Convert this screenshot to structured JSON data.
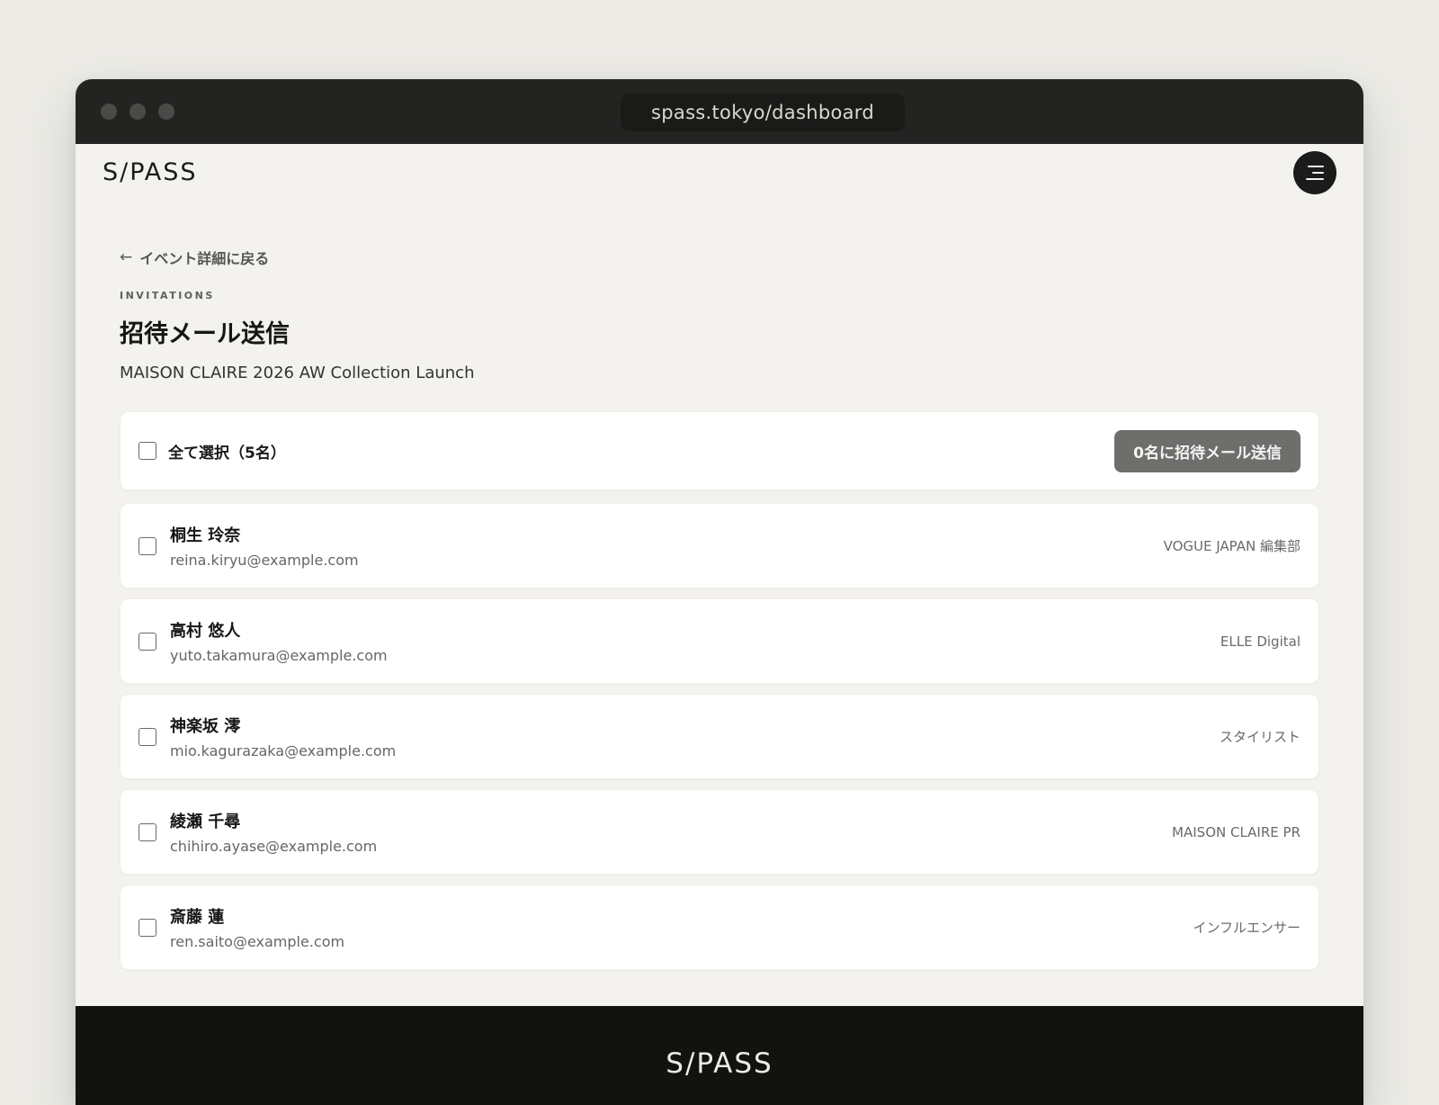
{
  "browser": {
    "url": "spass.tokyo/dashboard"
  },
  "header": {
    "logo": "S/PASS",
    "menu_icon": "hamburger-menu-icon"
  },
  "back_link": {
    "arrow": "←",
    "label": "イベント詳細に戻る"
  },
  "page": {
    "eyebrow": "INVITATIONS",
    "title": "招待メール送信",
    "event_name": "MAISON CLAIRE 2026 AW Collection Launch"
  },
  "selection": {
    "select_all_label": "全て選択（5名）",
    "send_button_label": "0名に招待メール送信",
    "selected_count": 0
  },
  "recipients": [
    {
      "name": "桐生 玲奈",
      "email": "reina.kiryu@example.com",
      "org": "VOGUE JAPAN 編集部",
      "checked": false
    },
    {
      "name": "高村 悠人",
      "email": "yuto.takamura@example.com",
      "org": "ELLE Digital",
      "checked": false
    },
    {
      "name": "神楽坂 澪",
      "email": "mio.kagurazaka@example.com",
      "org": "スタイリスト",
      "checked": false
    },
    {
      "name": "綾瀬 千尋",
      "email": "chihiro.ayase@example.com",
      "org": "MAISON CLAIRE PR",
      "checked": false
    },
    {
      "name": "斎藤 蓮",
      "email": "ren.saito@example.com",
      "org": "インフルエンサー",
      "checked": false
    }
  ],
  "footer": {
    "logo": "S/PASS"
  },
  "colors": {
    "page_bg": "#f3f2ee",
    "chrome_bg": "#232322",
    "button_disabled": "#6e6e6d",
    "footer_bg": "#121211"
  }
}
